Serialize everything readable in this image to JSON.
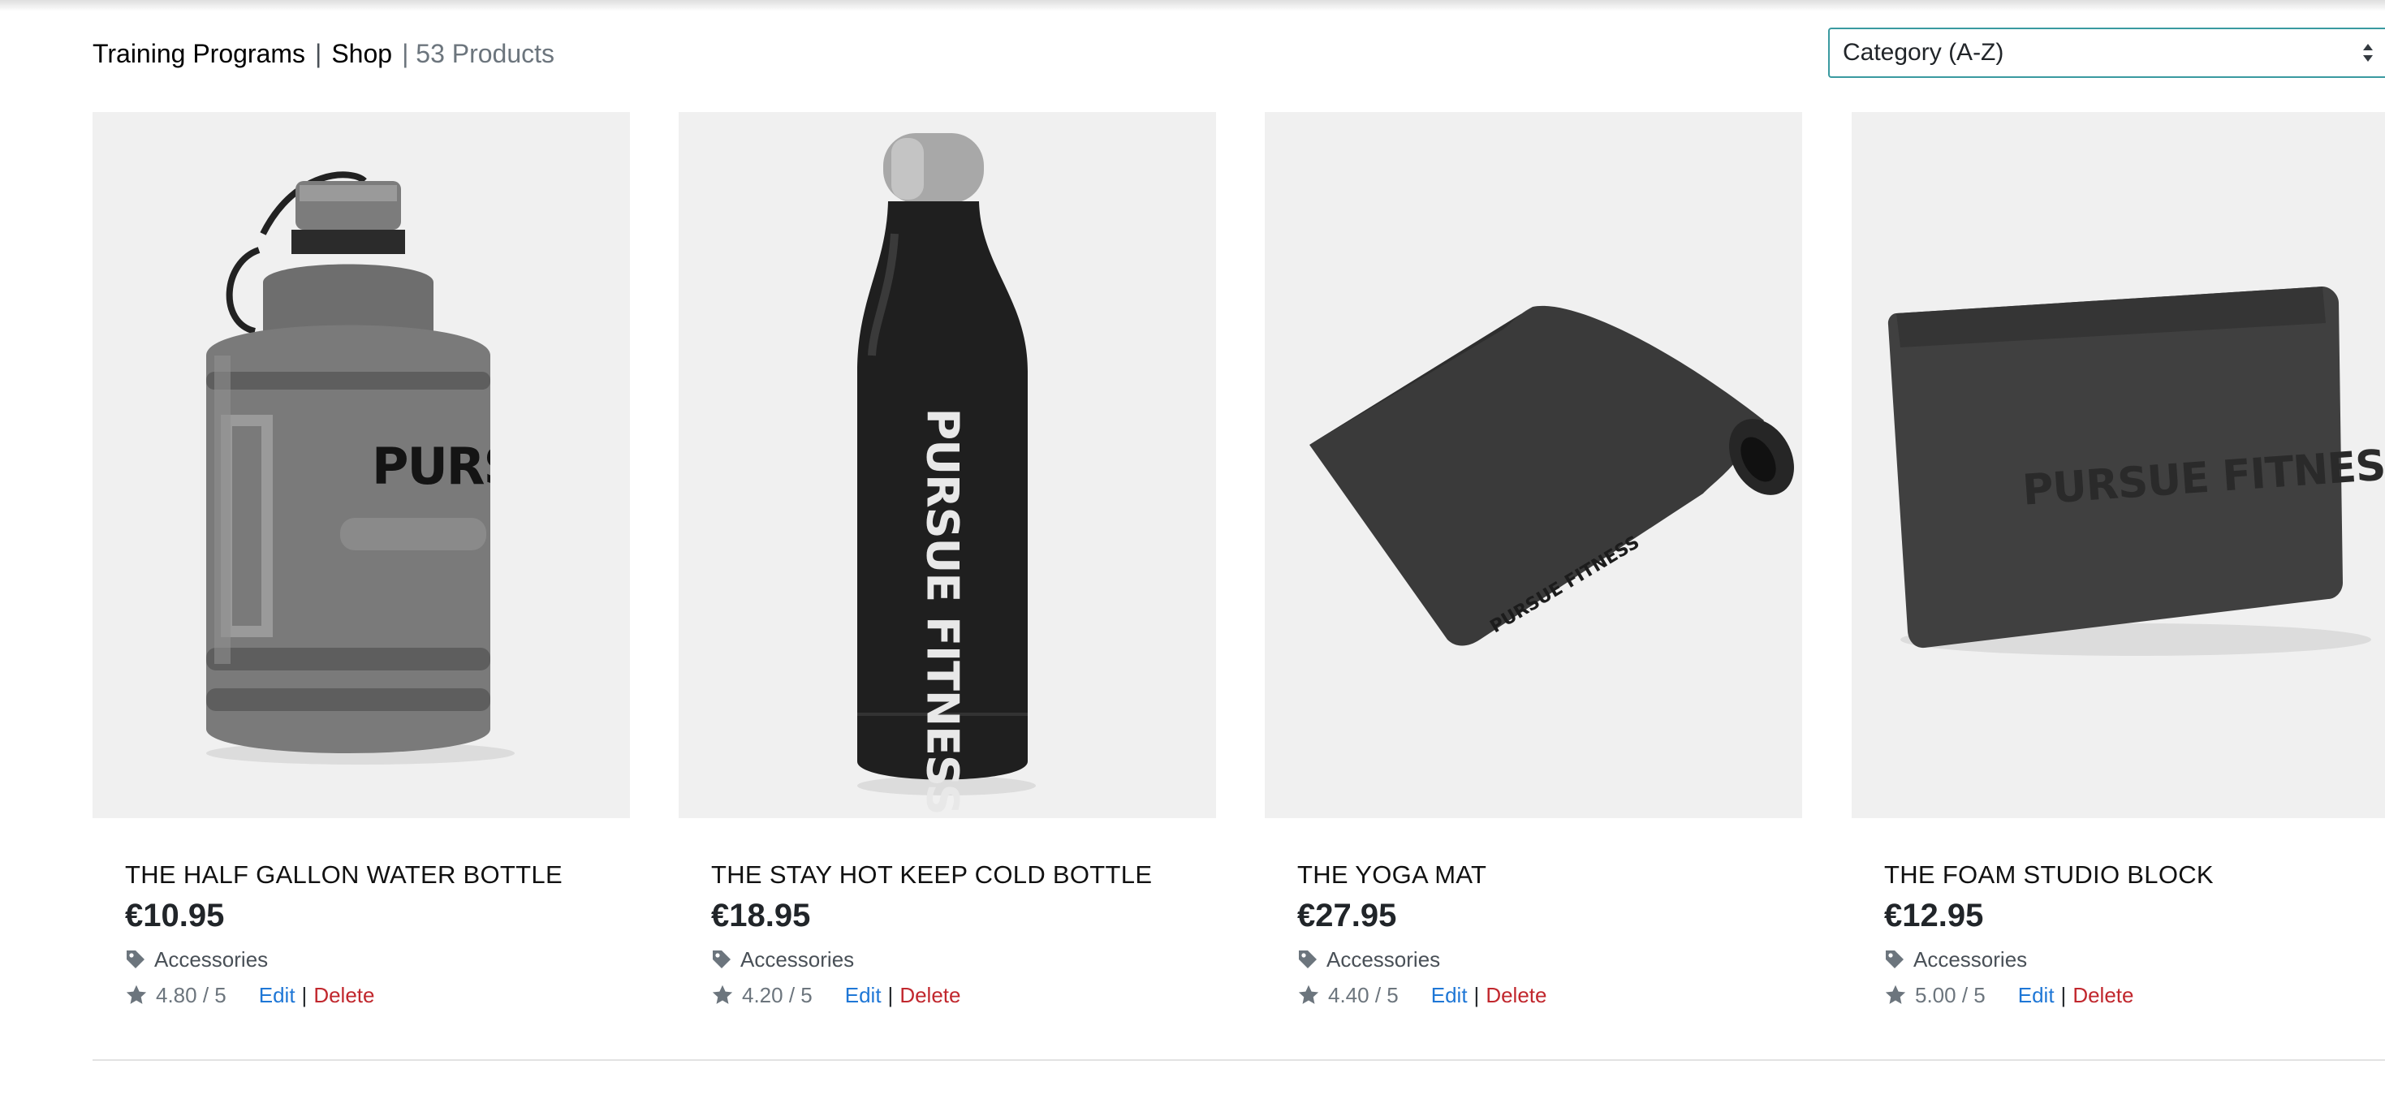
{
  "toolbar": {
    "crumb_1": "Training Programs",
    "separator": "|",
    "crumb_2": "Shop",
    "count": "| 53 Products"
  },
  "sort": {
    "selected": "Category (A-Z)"
  },
  "products": [
    {
      "title": "THE HALF GALLON WATER BOTTLE",
      "price": "€10.95",
      "category": "Accessories",
      "rating": "4.80 / 5",
      "image_brand": "PURSUE",
      "edit": "Edit",
      "delete": "Delete"
    },
    {
      "title": "THE STAY HOT KEEP COLD BOTTLE",
      "price": "€18.95",
      "category": "Accessories",
      "rating": "4.20 / 5",
      "image_brand": "PURSUE FITNESS",
      "edit": "Edit",
      "delete": "Delete"
    },
    {
      "title": "THE YOGA MAT",
      "price": "€27.95",
      "category": "Accessories",
      "rating": "4.40 / 5",
      "image_brand": "PURSUE FITNESS",
      "edit": "Edit",
      "delete": "Delete"
    },
    {
      "title": "THE FOAM STUDIO BLOCK",
      "price": "€12.95",
      "category": "Accessories",
      "rating": "5.00 / 5",
      "image_brand": "PURSUE FITNESS",
      "edit": "Edit",
      "delete": "Delete"
    }
  ],
  "colors": {
    "edit_link": "#1f77d6",
    "delete_link": "#c1272d",
    "select_border": "#3a9aa0",
    "image_bg": "#f0f0f0"
  },
  "icons": {
    "category": "tag-icon",
    "rating": "star-icon",
    "sort": "sort-arrows-icon"
  }
}
